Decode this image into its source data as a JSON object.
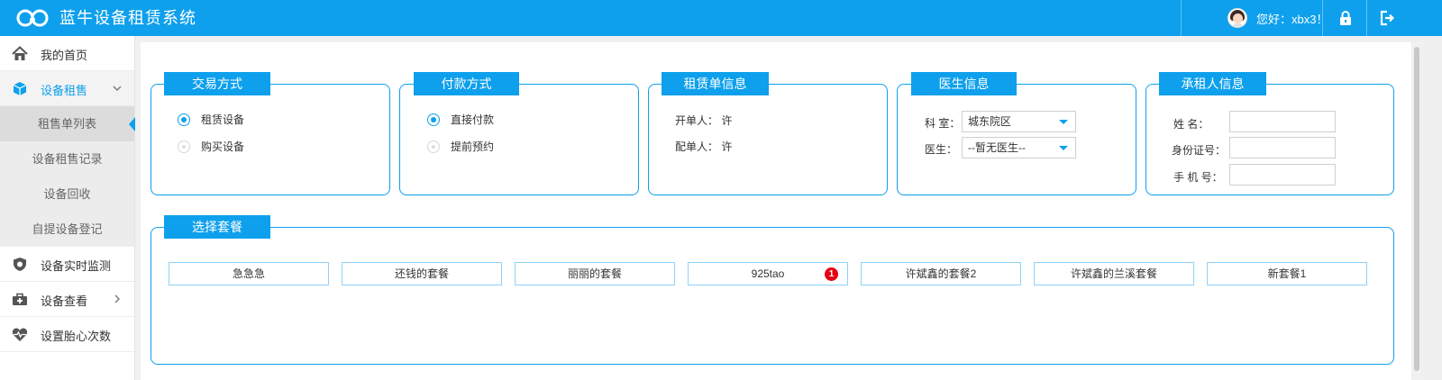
{
  "header": {
    "app_title": "蓝牛设备租赁系统",
    "greeting": "您好：xbx3！",
    "icons": [
      "logo-icon",
      "avatar",
      "lock-icon",
      "logout-icon"
    ]
  },
  "sidebar": {
    "items": [
      {
        "label": "我的首页",
        "icon": "home-icon"
      },
      {
        "label": "设备租售",
        "icon": "cube-icon",
        "expanded": true
      },
      {
        "label": "设备实时监测",
        "icon": "shield-icon"
      },
      {
        "label": "设备查看",
        "icon": "toolbox-icon"
      },
      {
        "label": "设置胎心次数",
        "icon": "heartbeat-icon"
      }
    ],
    "sub_items": [
      {
        "label": "租售单列表",
        "selected": true
      },
      {
        "label": "设备租售记录"
      },
      {
        "label": "设备回收"
      },
      {
        "label": "自提设备登记"
      }
    ]
  },
  "panels": {
    "trade": {
      "title": "交易方式",
      "options": [
        "租赁设备",
        "购买设备"
      ],
      "selected": 0
    },
    "payment": {
      "title": "付款方式",
      "options": [
        "直接付款",
        "提前预约"
      ],
      "selected": 0
    },
    "order": {
      "title": "租赁单信息",
      "opener_label": "开单人：",
      "opener_value": "许",
      "dispatcher_label": "配单人：",
      "dispatcher_value": "许"
    },
    "doctor": {
      "title": "医生信息",
      "dept_label": "科 室：",
      "dept_value": "城东院区",
      "doctor_label": "医生：",
      "doctor_value": "--暂无医生--"
    },
    "renter": {
      "title": "承租人信息",
      "name_label": "姓 名：",
      "id_label": "身份证号：",
      "phone_label": "手 机 号：",
      "name_value": "",
      "id_value": "",
      "phone_value": ""
    },
    "packages": {
      "title": "选择套餐",
      "items": [
        {
          "label": "急急急"
        },
        {
          "label": "还钱的套餐"
        },
        {
          "label": "丽丽的套餐"
        },
        {
          "label": "925tao",
          "badge": "1"
        },
        {
          "label": "许斌鑫的套餐2"
        },
        {
          "label": "许斌鑫的兰溪套餐"
        },
        {
          "label": "新套餐1"
        }
      ]
    }
  },
  "colors": {
    "accent": "#0ea0ec",
    "badge": "#e60012",
    "header_bg": "#0ea0ec"
  }
}
